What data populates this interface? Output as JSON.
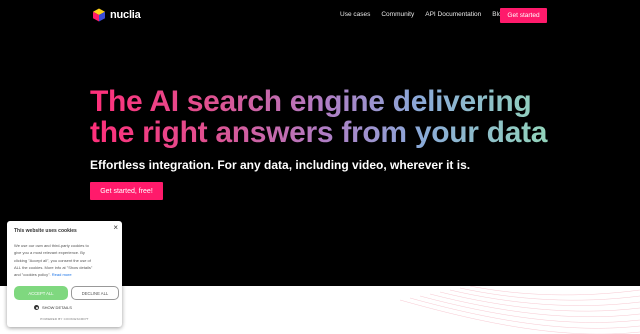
{
  "header": {
    "brand": "nuclia",
    "nav": [
      "Use cases",
      "Community",
      "API Documentation",
      "Blog"
    ],
    "cta": "Get started"
  },
  "hero": {
    "title_line1": "The AI search engine delivering",
    "title_line2": "the right answers from your data",
    "subtitle": "Effortless integration. For any data, including video, wherever it is.",
    "cta": "Get started, free!"
  },
  "cookie_banner": {
    "title": "This website uses cookies",
    "close": "×",
    "body_lines": [
      "We use our own and third-party cookies to",
      "give you a most relevant experience. By",
      "clicking \"Accept all\", you consent the use of",
      "ALL the cookies. More info at \"Show details\""
    ],
    "body_last": "and \"cookies policy\".",
    "read_more": "Read more",
    "accept": "ACCEPT ALL",
    "decline": "DECLINE ALL",
    "show_details": "SHOW DETAILS",
    "powered_by": "POWERED BY COOKIESCRIPT"
  },
  "colors": {
    "accent": "#ff1a6b",
    "accept_green": "#7fd87f"
  },
  "icons": {
    "logo": "cube-logo-icon",
    "close": "close-icon",
    "settings": "gear-icon"
  }
}
